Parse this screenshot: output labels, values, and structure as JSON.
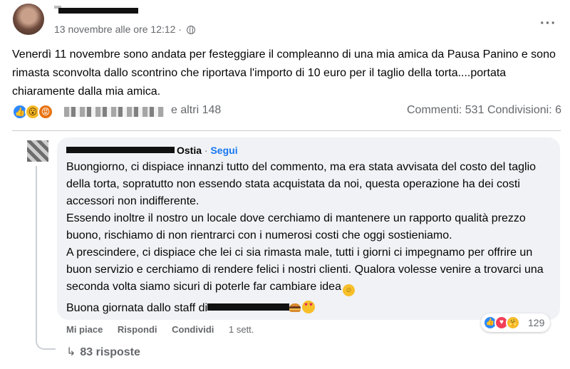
{
  "post": {
    "timestamp": "13 novembre alle ore 12:12 ·",
    "audience_icon": "globe-icon",
    "body": "Venerdì 11 novembre sono andata per festeggiare il compleanno di una mia amica da Pausa Panino e sono rimasta sconvolta dallo scontrino che riportava l'importo di 10 euro per il taglio della torta....portata chiaramente dalla mia amica.",
    "reactions_others": "e altri 148",
    "comments_count": "Commenti: 531",
    "shares_count": "Condivisioni: 6",
    "reaction_icons": [
      "like-icon",
      "wow-icon",
      "angry-icon"
    ]
  },
  "comment": {
    "author_suffix": "Ostia",
    "follow_label": "Segui",
    "paragraph1": "Buongiorno, ci dispiace innanzi tutto del commento, ma era stata avvisata del costo del taglio della torta, sopratutto non essendo stata acquistata da noi, questa operazione ha dei costi accessori non indifferente.",
    "paragraph2": "Essendo inoltre il nostro un locale dove cerchiamo di mantenere un rapporto qualità prezzo buono, rischiamo di non rientrarci con i numerosi costi che oggi sostieniamo.",
    "paragraph3": "A prescindere, ci dispiace che lei ci sia rimasta male, tutti i giorni ci impegnamo per offrire un buon servizio e cerchiamo di rendere felici i nostri clienti. Qualora volesse venire a trovarci una seconda volta siamo sicuri di poterle far cambiare idea",
    "closing": "Buona giornata dallo staff di",
    "reaction_count": "129",
    "actions": {
      "like": "Mi piace",
      "reply": "Rispondi",
      "share": "Condividi",
      "time": "1 sett."
    },
    "replies": "83 risposte"
  }
}
